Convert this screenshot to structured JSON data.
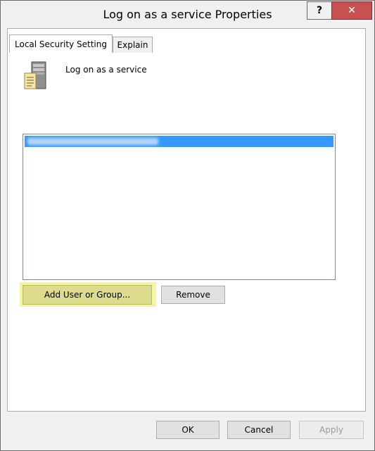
{
  "window": {
    "title": "Log on as a service Properties",
    "help_glyph": "?",
    "close_glyph": "✕"
  },
  "tabs": [
    {
      "label": "Local Security Setting",
      "active": true
    },
    {
      "label": "Explain",
      "active": false
    }
  ],
  "policy": {
    "icon": "server-policy-icon",
    "label": "Log on as a service"
  },
  "accounts_list": {
    "selected_index": 0
  },
  "buttons": {
    "add_label": "Add User or Group...",
    "remove_label": "Remove",
    "ok_label": "OK",
    "cancel_label": "Cancel",
    "apply_label": "Apply"
  },
  "colors": {
    "selection": "#3399ff",
    "highlight": "#f4f4a6",
    "close_button": "#c75050"
  }
}
